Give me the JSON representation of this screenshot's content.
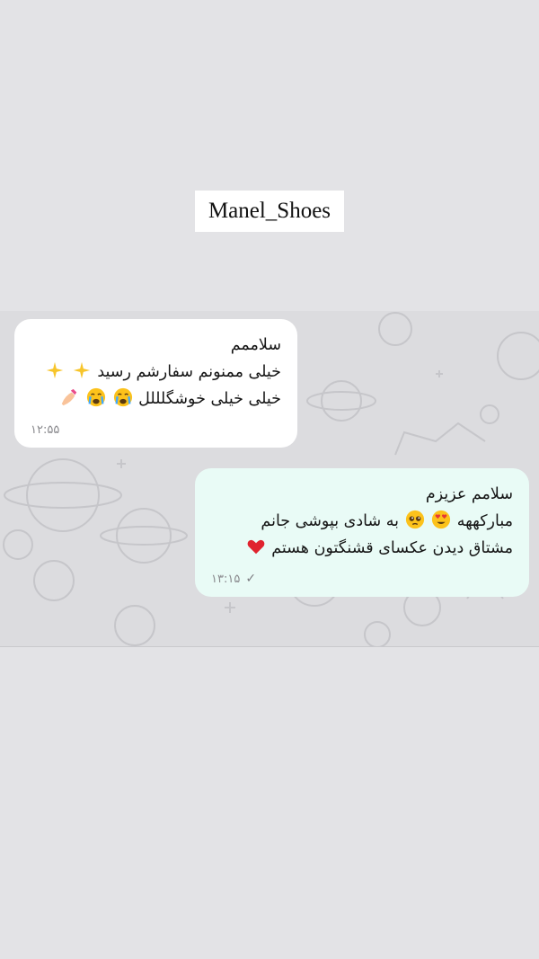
{
  "brand": {
    "label": "Manel_Shoes"
  },
  "messages": [
    {
      "direction": "incoming",
      "lines": [
        "سلاممم",
        "خیلی ممنونم سفارشم رسید",
        "خیلی خیلی خوشگلللل"
      ],
      "emojis": {
        "line2": [
          "sparkles-icon",
          "sparkles-icon"
        ],
        "line3": [
          "loudly-crying-face-icon",
          "loudly-crying-face-icon",
          "nail-polish-icon"
        ]
      },
      "time": "۱۲:۵۵"
    },
    {
      "direction": "outgoing",
      "lines": [
        "سلامم عزیزم",
        "مبارکههه",
        "به شادی بپوشی جانم",
        "مشتاق دیدن عکسای قشنگتون هستم"
      ],
      "emojis": {
        "line2": [
          "smiling-face-with-heart-eyes-icon",
          "pleading-face-icon"
        ],
        "line3": [
          "red-heart-icon"
        ]
      },
      "time": "۱۳:۱۵",
      "status": "sent"
    }
  ],
  "colors": {
    "page_background": "#e3e3e6",
    "chat_background": "#dcdcdf",
    "incoming_bubble": "#ffffff",
    "outgoing_bubble": "#e9fbf6"
  }
}
